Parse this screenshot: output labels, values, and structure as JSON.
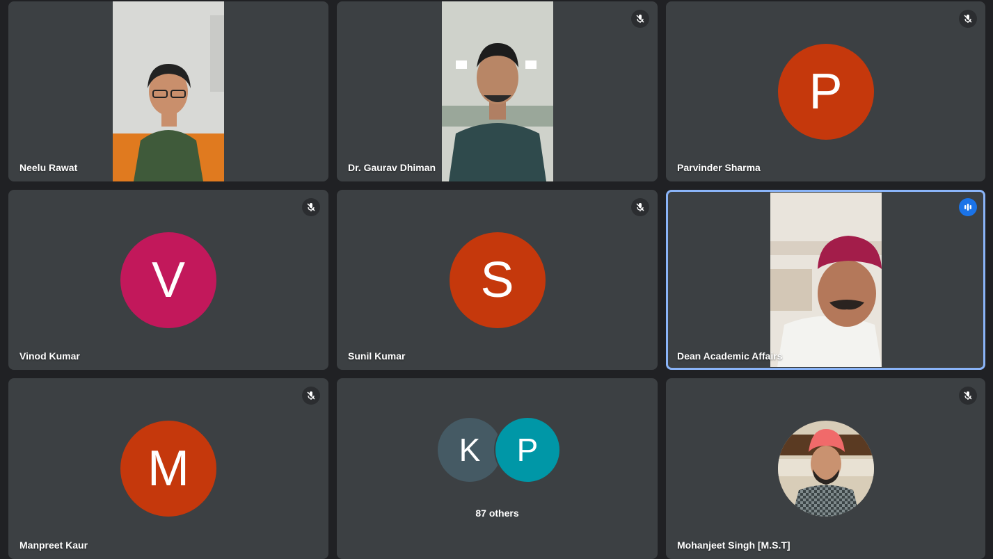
{
  "colors": {
    "background": "#202124",
    "tile": "#3c4043",
    "active_border": "#8ab4f8",
    "speaking_badge": "#1a73e8"
  },
  "tiles": [
    {
      "name": "Neelu Rawat",
      "type": "video",
      "muted": false
    },
    {
      "name": "Dr. Gaurav Dhiman",
      "type": "video",
      "muted": true
    },
    {
      "name": "Parvinder Sharma",
      "type": "avatar",
      "initial": "P",
      "color": "#c5380c",
      "muted": true
    },
    {
      "name": "Vinod Kumar",
      "type": "avatar",
      "initial": "V",
      "color": "#c2185b",
      "muted": true
    },
    {
      "name": "Sunil Kumar",
      "type": "avatar",
      "initial": "S",
      "color": "#c5380c",
      "muted": true
    },
    {
      "name": "Dean Academic Affairs",
      "type": "video",
      "speaking": true
    },
    {
      "name": "Manpreet Kaur",
      "type": "avatar",
      "initial": "M",
      "color": "#c5380c",
      "muted": true
    },
    {
      "type": "group",
      "initials": [
        "K",
        "P"
      ],
      "colors": [
        "#455a64",
        "#0097a7"
      ],
      "label": "87 others"
    },
    {
      "name": "Mohanjeet Singh [M.S.T]",
      "type": "photo-avatar",
      "muted": true
    }
  ]
}
